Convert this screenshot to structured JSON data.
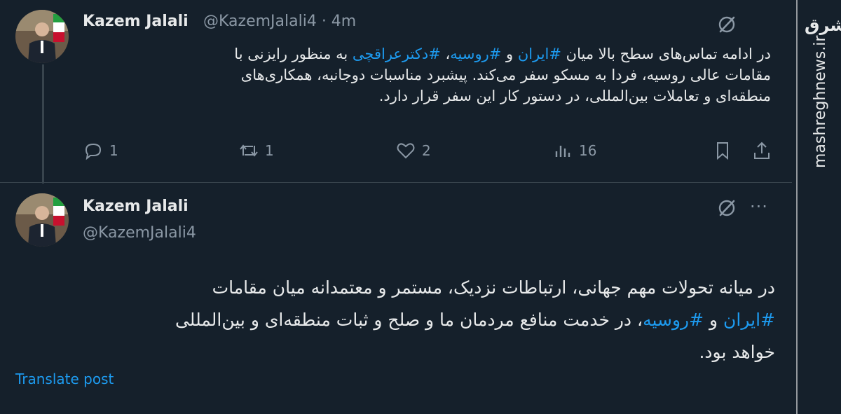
{
  "tweet1": {
    "author_name": "Kazem Jalali",
    "meta": "@KazemJalali4 · 4m",
    "text_lines": [
      [
        "در ادامه تماس‌های سطح بالا میان ",
        "#ایران",
        " و ",
        "#روسیه",
        "، ",
        "#دکترعراقچی",
        " به منظور رایزنی با"
      ],
      [
        "مقامات عالی روسیه، فردا به مسکو سفر می‌کند. پیشبرد مناسبات دوجانبه، همکاری‌های"
      ],
      [
        "منطقه‌ای و تعاملات بین‌المللی، در دستور کار این سفر قرار دارد."
      ]
    ],
    "line1_plain_before": "در ادامه تماس‌های سطح بالا میان ",
    "line1_tag_iran": "#ایران",
    "line1_and": " و ",
    "line1_tag_russia": "#روسیه",
    "line1_comma": "، ",
    "line1_tag_araghchi": "#دکترعراقچی",
    "line1_plain_after": " به منظور رایزنی با",
    "line2": "مقامات عالی روسیه، فردا به مسکو سفر می‌کند. پیشبرد مناسبات دوجانبه، همکاری‌های",
    "line3": "منطقه‌ای و تعاملات بین‌المللی، در دستور کار این سفر قرار دارد.",
    "replies": "1",
    "reposts": "1",
    "likes": "2",
    "views": "16"
  },
  "tweet2": {
    "author_name": "Kazem Jalali",
    "handle": "@KazemJalali4",
    "more_label": "···",
    "line1": "در میانه تحولات مهم جهانی، ارتباطات نزدیک، مستمر و معتمدانه میان مقامات",
    "line2_tag_iran": "#ایران",
    "line2_and": " و ",
    "line2_tag_russia": "#روسیه",
    "line2_rest": "، در خدمت منافع مردمان ما و صلح و ثبات منطقه‌ای و بین‌المللی",
    "line3": "خواهد بود.",
    "translate_label": "Translate post"
  },
  "watermark": {
    "site": "mashreghnews.ir",
    "logo": "مشرق"
  },
  "icons": {
    "grok": "grok-icon",
    "reply": "reply-icon",
    "repost": "repost-icon",
    "like": "like-icon",
    "views": "views-icon",
    "bookmark": "bookmark-icon",
    "share": "share-icon"
  },
  "colors": {
    "background": "#15202b",
    "accent": "#1d9bf0",
    "muted": "#8b98a5",
    "text": "#e7e9ea"
  }
}
